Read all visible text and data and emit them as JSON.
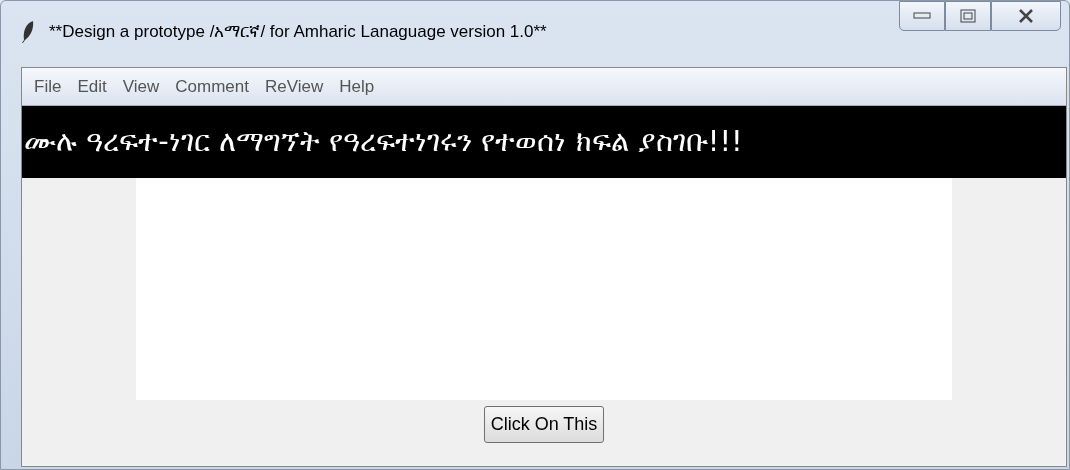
{
  "window": {
    "title": "**Design a prototype /አማርኛ/ for Amharic Lanaguage version 1.0**"
  },
  "menu": [
    "File",
    "Edit",
    "View",
    "Comment",
    "ReView",
    "Help"
  ],
  "banner": "ሙሉ ዓረፍተ-ነገር ለማግኘት የዓረፍተነገሩን የተወሰነ ክፍል ያስገቡ!!!",
  "button": "Click On This"
}
